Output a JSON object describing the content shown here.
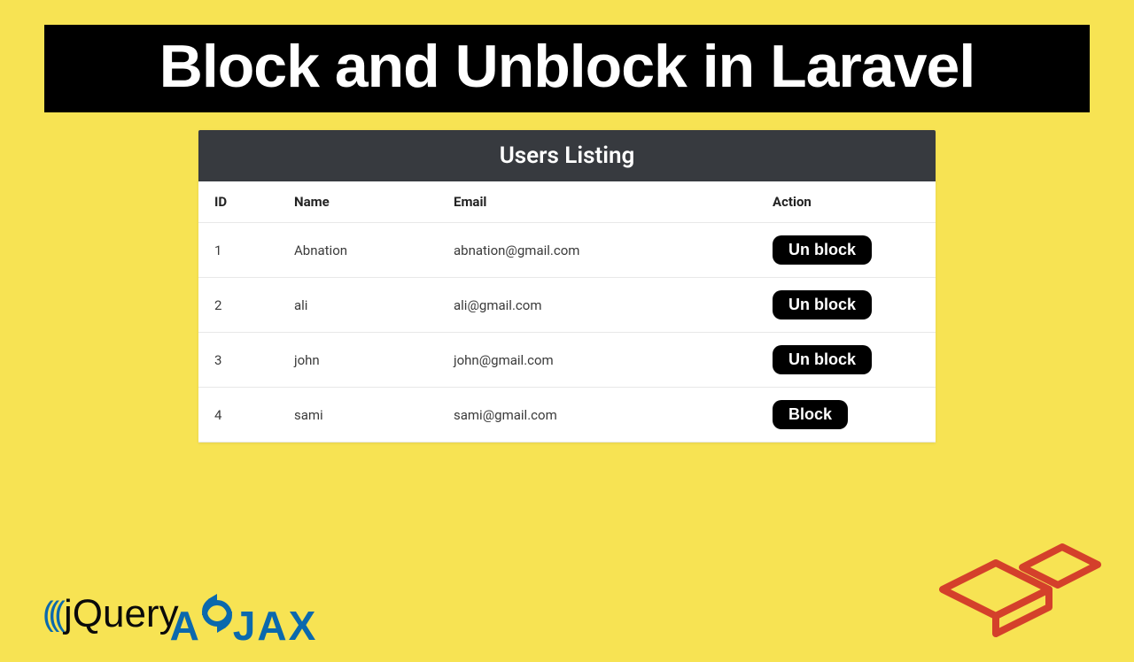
{
  "title": "Block and Unblock in Laravel",
  "panel": {
    "header": "Users Listing",
    "columns": [
      "ID",
      "Name",
      "Email",
      "Action"
    ],
    "rows": [
      {
        "id": "1",
        "name": "Abnation",
        "email": "abnation@gmail.com",
        "action": "Un block"
      },
      {
        "id": "2",
        "name": "ali",
        "email": "ali@gmail.com",
        "action": "Un block"
      },
      {
        "id": "3",
        "name": "john",
        "email": "john@gmail.com",
        "action": "Un block"
      },
      {
        "id": "4",
        "name": "sami",
        "email": "sami@gmail.com",
        "action": "Block"
      }
    ]
  },
  "logos": {
    "jquery": "jQuery",
    "ajax_a": "A",
    "ajax_jax": "JAX"
  }
}
